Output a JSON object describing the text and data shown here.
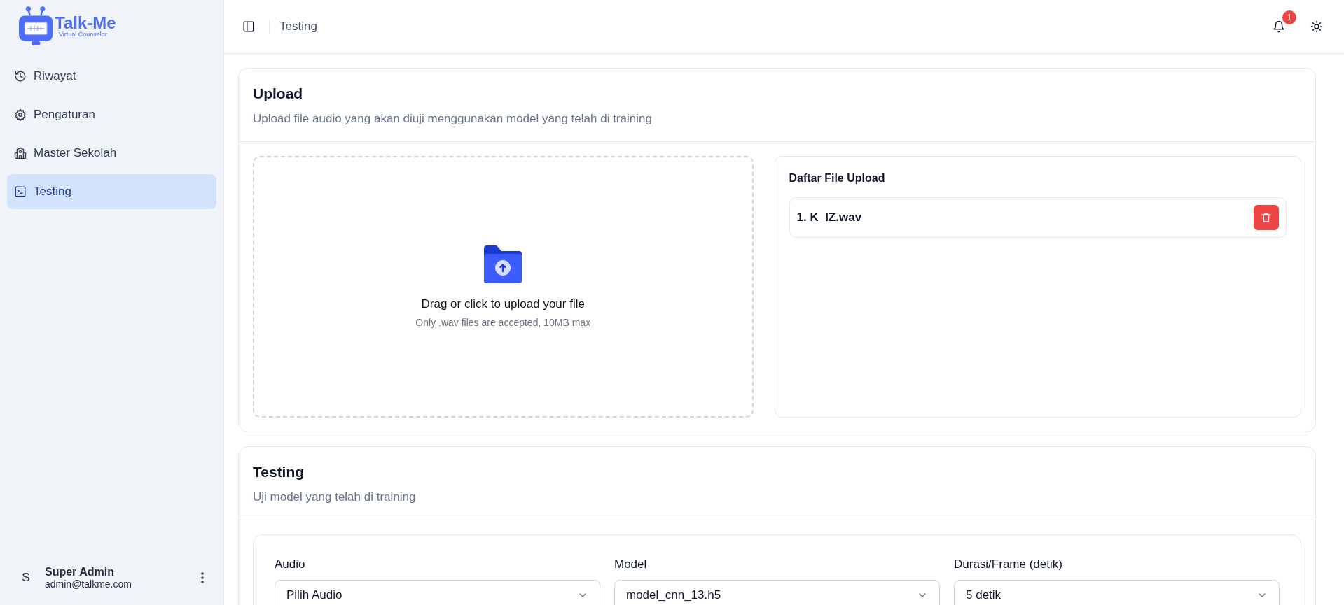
{
  "logo": {
    "name": "Talk-Me",
    "tagline": "Virtual Counselor"
  },
  "sidebar": {
    "items": [
      {
        "label": "Riwayat",
        "selected": false
      },
      {
        "label": "Pengaturan",
        "selected": false
      },
      {
        "label": "Master Sekolah",
        "selected": false
      },
      {
        "label": "Testing",
        "selected": true
      }
    ],
    "user": {
      "initial": "S",
      "name": "Super Admin",
      "email": "admin@talkme.com"
    }
  },
  "topbar": {
    "breadcrumb": "Testing",
    "notification_count": "1"
  },
  "upload": {
    "title": "Upload",
    "description": "Upload file audio yang akan diuji menggunakan model yang telah di training",
    "dropzone": {
      "text": "Drag or click to upload your file",
      "hint": "Only .wav files are accepted, 10MB max"
    },
    "file_list": {
      "title": "Daftar File Upload",
      "files": [
        "1. K_IZ.wav"
      ]
    }
  },
  "testing": {
    "title": "Testing",
    "description": "Uji model yang telah di training",
    "fields": [
      {
        "label": "Audio",
        "value": "Pilih Audio"
      },
      {
        "label": "Model",
        "value": "model_cnn_13.h5"
      },
      {
        "label": "Durasi/Frame (detik)",
        "value": "5 detik"
      }
    ]
  }
}
